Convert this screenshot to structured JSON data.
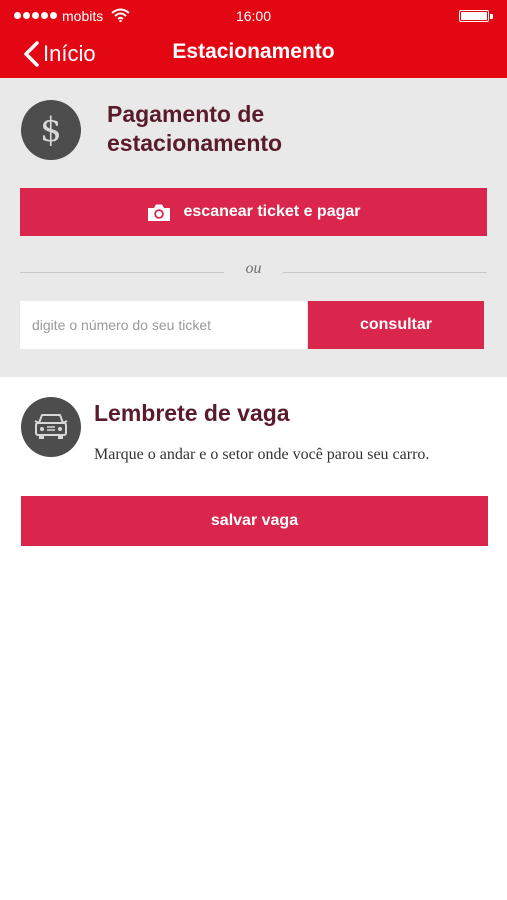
{
  "status_bar": {
    "carrier": "mobits",
    "time": "16:00"
  },
  "nav": {
    "back_label": "Início",
    "title": "Estacionamento"
  },
  "payment": {
    "title": "Pagamento de estacionamento",
    "scan_button_label": "escanear ticket e pagar",
    "divider_text": "ou",
    "ticket_input_placeholder": "digite o número do seu ticket",
    "ticket_input_value": "",
    "consult_button_label": "consultar"
  },
  "reminder": {
    "title": "Lembrete de vaga",
    "description": "Marque o andar e o setor onde você parou seu carro.",
    "save_button_label": "salvar vaga"
  },
  "icons": {
    "back": "chevron-left-icon",
    "payment": "dollar-icon",
    "scan": "camera-icon",
    "reminder": "car-icon"
  },
  "colors": {
    "header_bg": "#e30713",
    "button_bg": "#da254c",
    "title_text": "#5a1c2b",
    "icon_circle": "#4e4d4d",
    "panel_bg": "#e9e9e9"
  }
}
